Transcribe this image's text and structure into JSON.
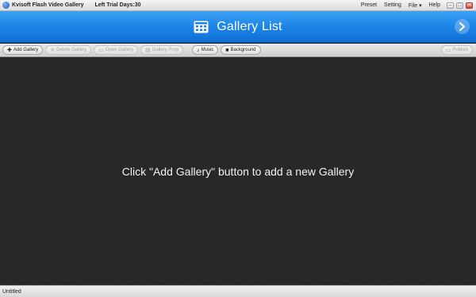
{
  "titlebar": {
    "app_title": "Kvisoft Flash Video Gallery",
    "trial": "Left Trial Days:30",
    "menus": [
      "Preset",
      "Setting",
      "File ▾",
      "Help"
    ]
  },
  "header": {
    "title": "Gallery List"
  },
  "toolbar": {
    "add_gallery": "Add Gallery",
    "delete_gallery": "Delete Gallery",
    "open_gallery": "Open Gallery",
    "gallery_prop": "Gallery Prop",
    "music": "Music",
    "background": "Background",
    "publish": "Publish"
  },
  "main": {
    "hint": "Click \"Add Gallery\" button to add a new Gallery"
  },
  "status": {
    "document": "Untitled"
  },
  "colors": {
    "header_blue": "#1b82e6",
    "canvas_bg": "#262626"
  }
}
